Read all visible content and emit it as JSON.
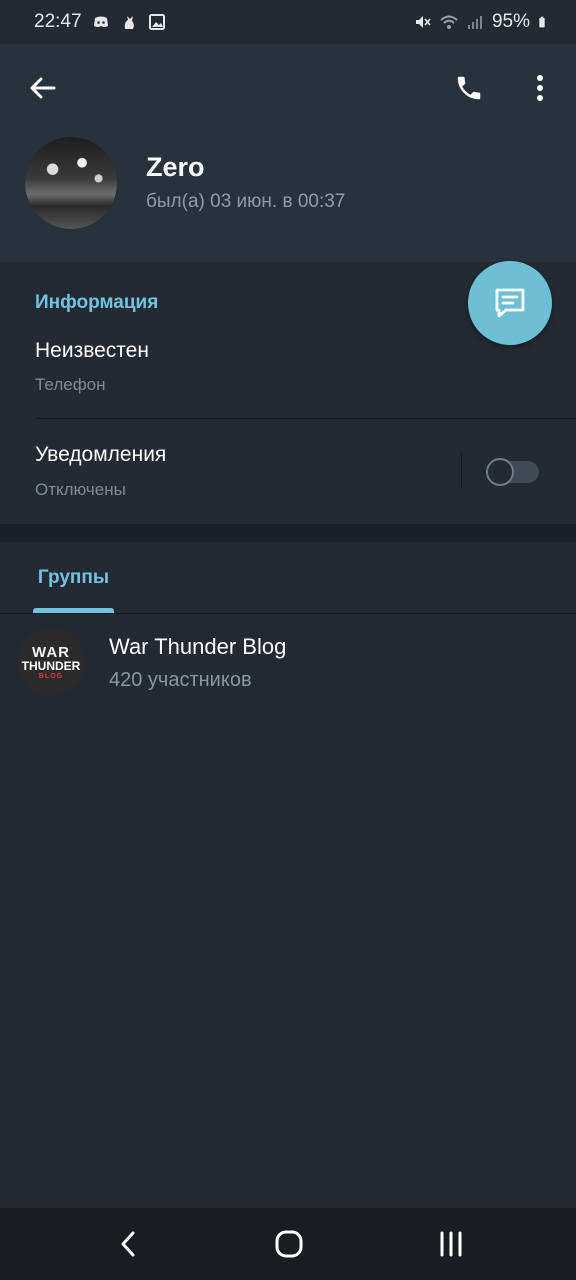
{
  "status_bar": {
    "time": "22:47",
    "battery_percent": "95%",
    "left_icons": [
      "discord-icon",
      "cat-icon",
      "image-icon"
    ],
    "right_icons": [
      "mute-icon",
      "wifi-icon",
      "signal-icon",
      "battery-icon"
    ]
  },
  "header": {
    "back_icon": "arrow-left-icon",
    "call_icon": "phone-icon",
    "more_icon": "more-vertical-icon"
  },
  "profile": {
    "name": "Zero",
    "last_seen": "был(а) 03 июн. в 00:37"
  },
  "fab": {
    "icon": "message-icon"
  },
  "info": {
    "title": "Информация",
    "phone": {
      "value": "Неизвестен",
      "label": "Телефон"
    },
    "notifications": {
      "value": "Уведомления",
      "label": "Отключены",
      "enabled": false
    }
  },
  "tabs": [
    {
      "label": "Группы",
      "active": true
    }
  ],
  "groups": [
    {
      "name": "War Thunder Blog",
      "members": "420 участников",
      "logo": {
        "line1": "WAR",
        "line2": "THUNDER",
        "line3": "BLOG"
      }
    }
  ],
  "nav_bar": {
    "back_icon": "nav-back-icon",
    "home_icon": "nav-home-icon",
    "recents_icon": "nav-recents-icon"
  },
  "colors": {
    "background": "#232a33",
    "header": "#28323c",
    "accent": "#71c3e0",
    "fab": "#6cbfd5",
    "secondary_text": "#7f8a96"
  }
}
